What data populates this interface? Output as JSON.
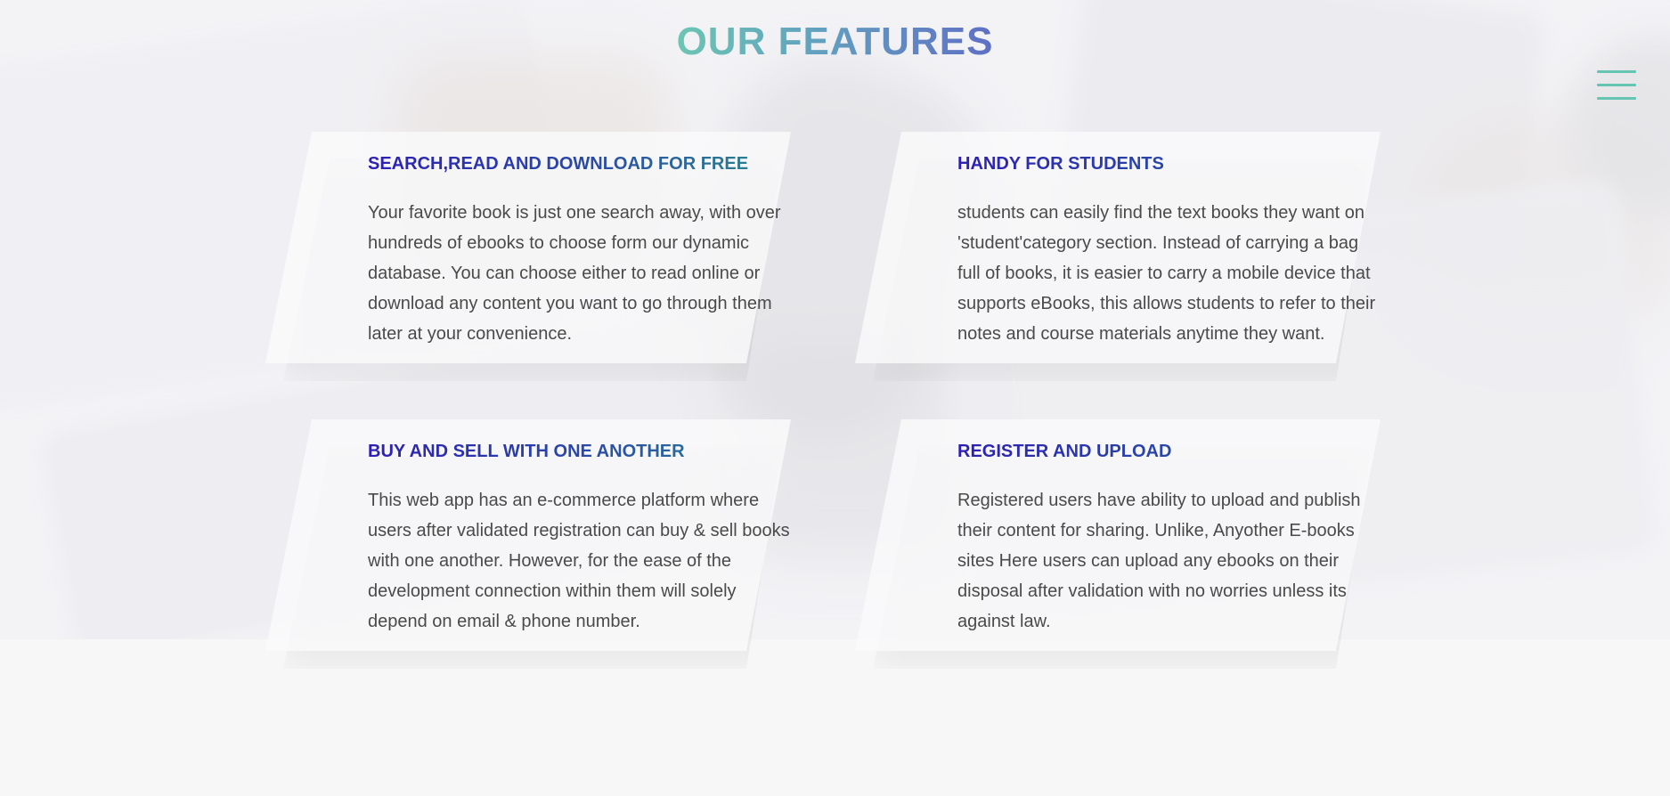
{
  "section": {
    "title": "OUR FEATURES"
  },
  "menu": {
    "icon": "hamburger-menu-icon"
  },
  "features": [
    {
      "title": "SEARCH,READ AND DOWNLOAD FOR FREE",
      "text": "Your favorite book is just one search away, with over hundreds of ebooks to choose form our dynamic database. You can choose either to read online or download any content you want to go through them later at your convenience."
    },
    {
      "title": "HANDY FOR STUDENTS",
      "text": "students can easily find the text books they want on 'student'category section. Instead of carrying a bag full of books, it is easier to carry a mobile device that supports eBooks, this allows students to refer to their notes and course materials anytime they want."
    },
    {
      "title": "BUY AND SELL WITH ONE ANOTHER",
      "text": "This web app has an e-commerce platform where users after validated registration can buy & sell books with one another. However, for the ease of the development connection within them will solely depend on email & phone number."
    },
    {
      "title": "REGISTER AND UPLOAD",
      "text": "Registered users have ability to upload and publish their content for sharing. Unlike, Anyother E-books sites Here users can upload any ebooks on their disposal after validation with no worries unless its against law."
    }
  ],
  "colors": {
    "accent_teal": "#66c4b3",
    "accent_indigo": "#2d1fb3",
    "text": "#4a4a4a"
  }
}
